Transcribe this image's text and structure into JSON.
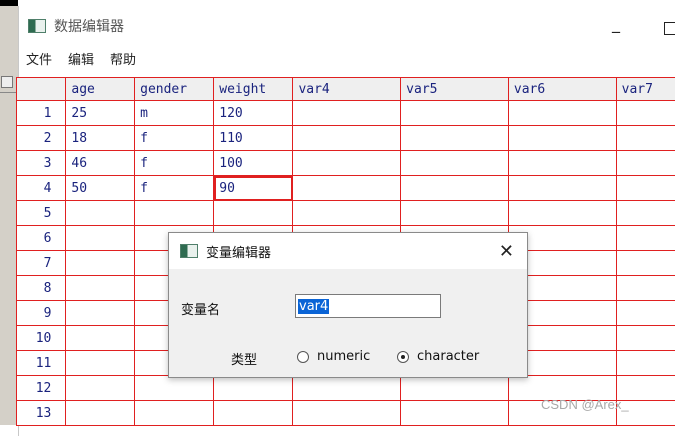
{
  "window": {
    "title": "数据编辑器",
    "min_label": "_"
  },
  "menu": [
    "文件",
    "编辑",
    "帮助"
  ],
  "grid": {
    "columns": [
      "age",
      "gender",
      "weight",
      "var4",
      "var5",
      "var6",
      "var7"
    ],
    "rows": [
      {
        "n": "1",
        "cells": [
          "25",
          "m",
          "120",
          "",
          "",
          "",
          ""
        ]
      },
      {
        "n": "2",
        "cells": [
          "18",
          "f",
          "110",
          "",
          "",
          "",
          ""
        ]
      },
      {
        "n": "3",
        "cells": [
          "46",
          "f",
          "100",
          "",
          "",
          "",
          ""
        ]
      },
      {
        "n": "4",
        "cells": [
          "50",
          "f",
          "90",
          "",
          "",
          "",
          ""
        ]
      },
      {
        "n": "5",
        "cells": [
          "",
          "",
          "",
          "",
          "",
          "",
          ""
        ]
      },
      {
        "n": "6",
        "cells": [
          "",
          "",
          "",
          "",
          "",
          "",
          ""
        ]
      },
      {
        "n": "7",
        "cells": [
          "",
          "",
          "",
          "",
          "",
          "",
          ""
        ]
      },
      {
        "n": "8",
        "cells": [
          "",
          "",
          "",
          "",
          "",
          "",
          ""
        ]
      },
      {
        "n": "9",
        "cells": [
          "",
          "",
          "",
          "",
          "",
          "",
          ""
        ]
      },
      {
        "n": "10",
        "cells": [
          "",
          "",
          "",
          "",
          "",
          "",
          ""
        ]
      },
      {
        "n": "11",
        "cells": [
          "",
          "",
          "",
          "",
          "",
          "",
          ""
        ]
      },
      {
        "n": "12",
        "cells": [
          "",
          "",
          "",
          "",
          "",
          "",
          ""
        ]
      },
      {
        "n": "13",
        "cells": [
          "",
          "",
          "",
          "",
          "",
          "",
          ""
        ]
      }
    ]
  },
  "dialog": {
    "title": "变量编辑器",
    "name_label": "变量名",
    "name_value": "var4",
    "type_label": "类型",
    "options": [
      "numeric",
      "character"
    ],
    "selected": "character"
  },
  "watermark": "CSDN @Arex_"
}
